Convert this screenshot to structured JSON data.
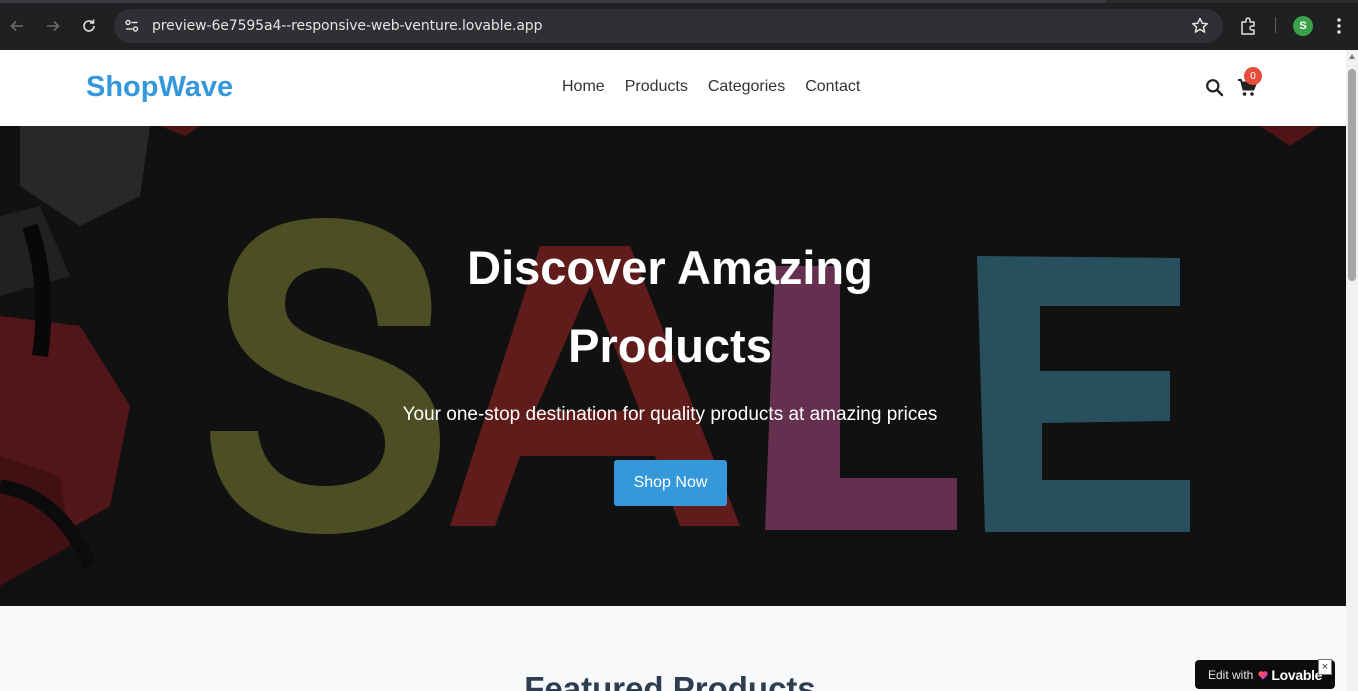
{
  "browser": {
    "url": "preview-6e7595a4--responsive-web-venture.lovable.app",
    "profile_initial": "S",
    "icons": [
      "back-icon",
      "forward-icon",
      "reload-icon",
      "site-settings-icon",
      "bookmark-star-icon",
      "extensions-icon",
      "menu-dots-icon"
    ]
  },
  "header": {
    "logo": "ShopWave",
    "nav": [
      "Home",
      "Products",
      "Categories",
      "Contact"
    ],
    "cart_count": "0",
    "icons": [
      "search-icon",
      "cart-icon"
    ]
  },
  "hero": {
    "title_line1": "Discover Amazing",
    "title_line2": "Products",
    "subtitle": "Your one-stop destination for quality products at amazing prices",
    "cta": "Shop Now"
  },
  "featured": {
    "title": "Featured Products"
  },
  "lovable_badge": {
    "edit_text": "Edit with",
    "brand": "Lovable",
    "close": "×"
  },
  "colors": {
    "brand": "#3498db",
    "badge": "#e74c3c",
    "header_bg": "#ffffff",
    "hero_overlay": "#141414",
    "chrome_bg": "#1f2021"
  }
}
